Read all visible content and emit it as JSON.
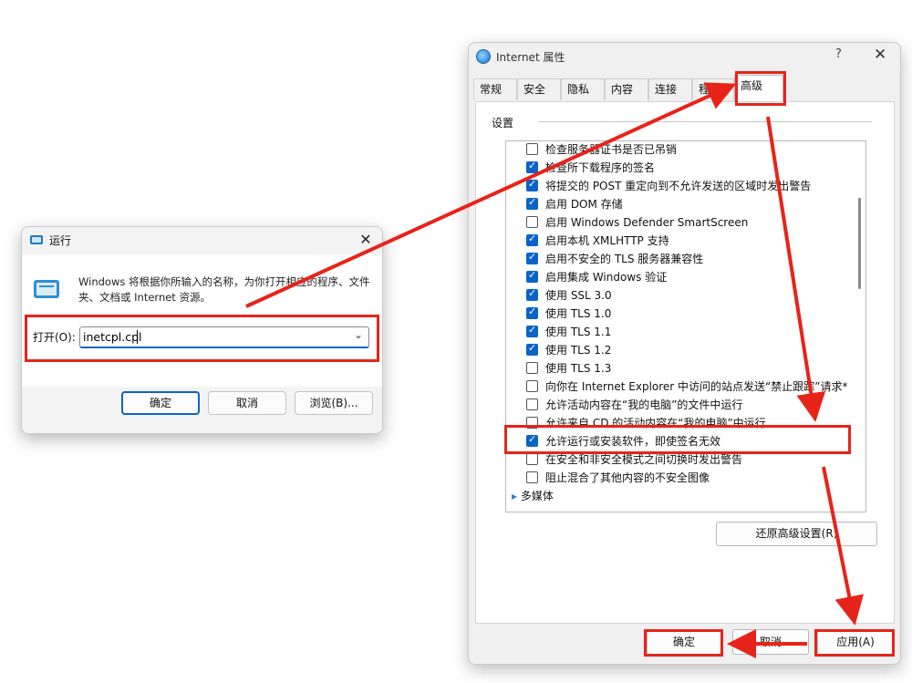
{
  "run_dialog": {
    "title": "运行",
    "description": "Windows 将根据你所输入的名称，为你打开相应的程序、文件夹、文档或 Internet 资源。",
    "open_label": "打开(O):",
    "command_value": "inetcpl.cpl",
    "buttons": {
      "ok": "确定",
      "cancel": "取消",
      "browse": "浏览(B)..."
    }
  },
  "internet_properties": {
    "title": "Internet 属性",
    "help_glyph": "?",
    "close_glyph": "✕",
    "tabs": [
      {
        "label": "常规"
      },
      {
        "label": "安全"
      },
      {
        "label": "隐私"
      },
      {
        "label": "内容"
      },
      {
        "label": "连接"
      },
      {
        "label": "程序"
      },
      {
        "label": "高级"
      }
    ],
    "active_tab": "高级",
    "settings_label": "设置",
    "settings": [
      {
        "label": "检查服务器证书是否已吊销",
        "checked": false
      },
      {
        "label": "检查所下载程序的签名",
        "checked": true
      },
      {
        "label": "将提交的 POST 重定向到不允许发送的区域时发出警告",
        "checked": true
      },
      {
        "label": "启用 DOM 存储",
        "checked": true
      },
      {
        "label": "启用 Windows Defender SmartScreen",
        "checked": false
      },
      {
        "label": "启用本机 XMLHTTP 支持",
        "checked": true
      },
      {
        "label": "启用不安全的 TLS 服务器兼容性",
        "checked": true
      },
      {
        "label": "启用集成 Windows 验证",
        "checked": true
      },
      {
        "label": "使用 SSL 3.0",
        "checked": true
      },
      {
        "label": "使用 TLS 1.0",
        "checked": true
      },
      {
        "label": "使用 TLS 1.1",
        "checked": true
      },
      {
        "label": "使用 TLS 1.2",
        "checked": true
      },
      {
        "label": "使用 TLS 1.3",
        "checked": false
      },
      {
        "label": "向你在 Internet Explorer 中访问的站点发送“禁止跟踪”请求*",
        "checked": false
      },
      {
        "label": "允许活动内容在“我的电脑”的文件中运行",
        "checked": false
      },
      {
        "label": "允许来自 CD 的活动内容在“我的电脑”中运行",
        "checked": false
      },
      {
        "label": "允许运行或安装软件，即使签名无效",
        "checked": true
      },
      {
        "label": "在安全和非安全模式之间切换时发出警告",
        "checked": false
      },
      {
        "label": "阻止混合了其他内容的不安全图像",
        "checked": false
      }
    ],
    "group_label": "多媒体",
    "reset_button": "还原高级设置(R)",
    "buttons": {
      "ok": "确定",
      "cancel": "取消",
      "apply": "应用(A)"
    }
  },
  "annotation_color": "#e8231a",
  "accent_color": "#0a64c8"
}
